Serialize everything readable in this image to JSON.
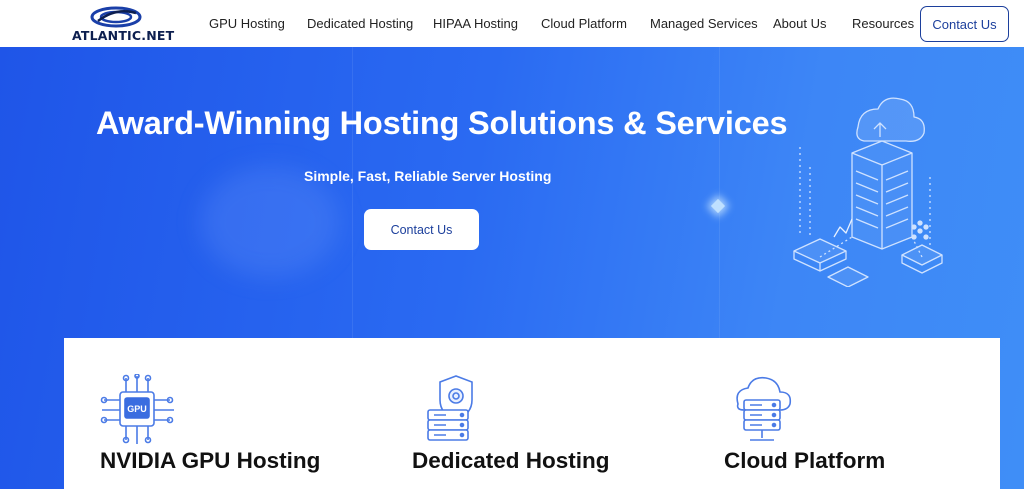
{
  "brand": {
    "name": "ATLANTIC.NET"
  },
  "nav": {
    "items": [
      {
        "label": "GPU Hosting"
      },
      {
        "label": "Dedicated Hosting"
      },
      {
        "label": "HIPAA Hosting"
      },
      {
        "label": "Cloud Platform"
      },
      {
        "label": "Managed Services"
      },
      {
        "label": "About Us"
      },
      {
        "label": "Resources"
      }
    ],
    "cta_label": "Contact Us"
  },
  "hero": {
    "title": "Award-Winning Hosting Solutions & Services",
    "subtitle": "Simple, Fast, Reliable Server Hosting",
    "button_label": "Contact Us",
    "illustration_icon": "server-cloud-isometric-icon"
  },
  "cards": [
    {
      "title": "NVIDIA GPU Hosting",
      "icon": "gpu-chip-icon",
      "icon_text": "GPU"
    },
    {
      "title": "Dedicated Hosting",
      "icon": "shield-server-icon"
    },
    {
      "title": "Cloud Platform",
      "icon": "cloud-server-icon"
    }
  ],
  "colors": {
    "brand_navy": "#1c3f9c",
    "hero_blue": "#2a6af2",
    "icon_blue": "#4b7be6"
  }
}
